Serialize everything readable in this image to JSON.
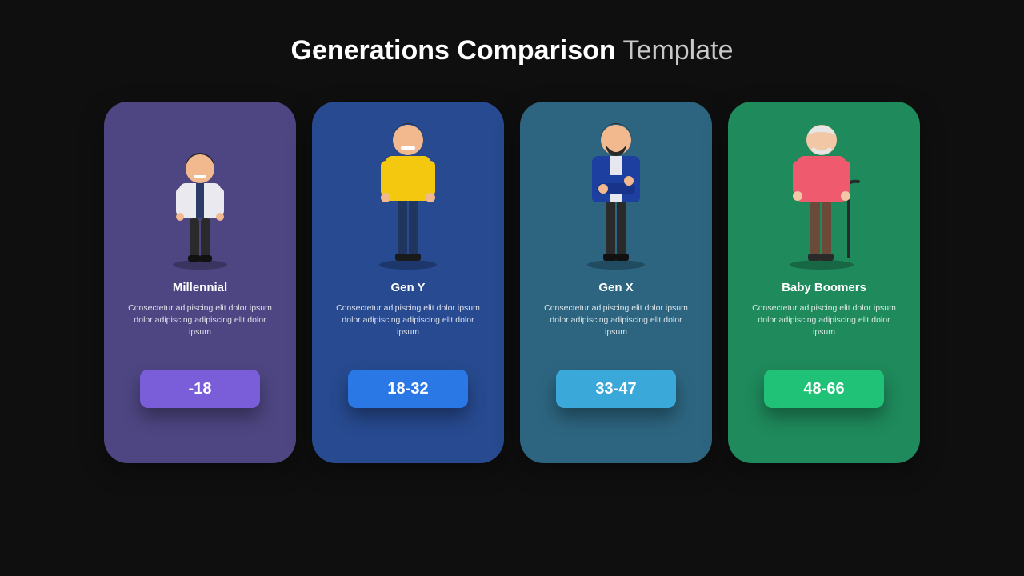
{
  "title": {
    "bold": "Generations Comparison",
    "rest": " Template"
  },
  "colors": {
    "card_bg": [
      "#4e4682",
      "#274a90",
      "#2d6580",
      "#1f8a5c"
    ],
    "chip_bg": [
      "#7a5ed9",
      "#2a77e6",
      "#3aa8d8",
      "#20c277"
    ]
  },
  "cards": [
    {
      "title": "Millennial",
      "desc": "Consectetur adipiscing elit dolor ipsum dolor adipiscing adipiscing elit dolor ipsum",
      "range": "-18"
    },
    {
      "title": "Gen Y",
      "desc": "Consectetur adipiscing elit dolor ipsum dolor adipiscing adipiscing elit dolor ipsum",
      "range": "18-32"
    },
    {
      "title": "Gen X",
      "desc": "Consectetur adipiscing elit dolor ipsum dolor adipiscing adipiscing elit dolor ipsum",
      "range": "33-47"
    },
    {
      "title": "Baby Boomers",
      "desc": "Consectetur adipiscing elit dolor ipsum dolor adipiscing adipiscing elit dolor ipsum",
      "range": "48-66"
    }
  ]
}
